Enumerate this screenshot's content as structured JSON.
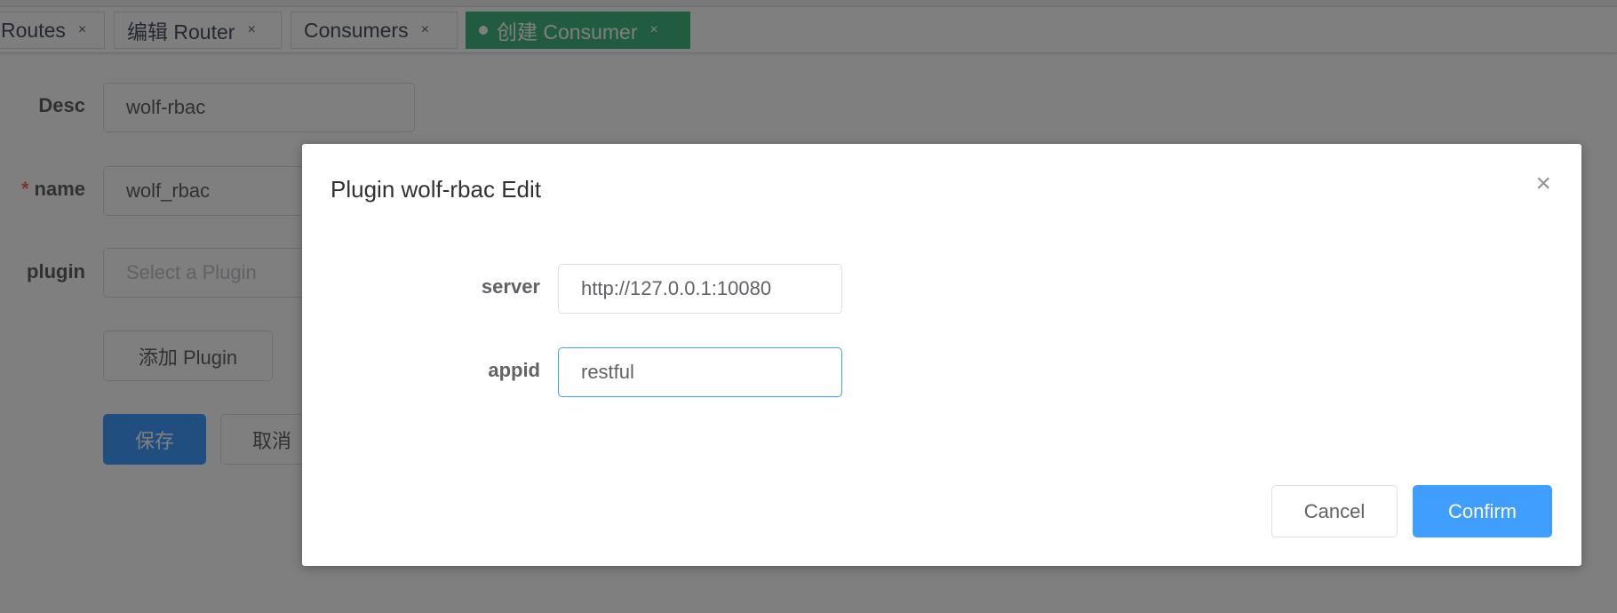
{
  "tabs": [
    {
      "label": "Routes",
      "close": "×"
    },
    {
      "label": "编辑 Router",
      "close": "×"
    },
    {
      "label": "Consumers",
      "close": "×"
    },
    {
      "label": "创建 Consumer",
      "close": "×",
      "active": true
    }
  ],
  "form": {
    "desc_label": "Desc",
    "desc_value": "wolf-rbac",
    "name_required": "*",
    "name_label": "name",
    "name_value": "wolf_rbac",
    "plugin_label": "plugin",
    "plugin_placeholder": "Select a Plugin",
    "add_plugin": "添加 Plugin",
    "save": "保存",
    "cancel": "取消"
  },
  "dialog": {
    "title": "Plugin wolf-rbac Edit",
    "close": "×",
    "fields": [
      {
        "label": "server",
        "value": "http://127.0.0.1:10080"
      },
      {
        "label": "appid",
        "value": "restful"
      }
    ],
    "cancel": "Cancel",
    "confirm": "Confirm"
  },
  "colors": {
    "accent": "#409eff",
    "tab_active": "#42b983",
    "required": "#f56c6c"
  }
}
